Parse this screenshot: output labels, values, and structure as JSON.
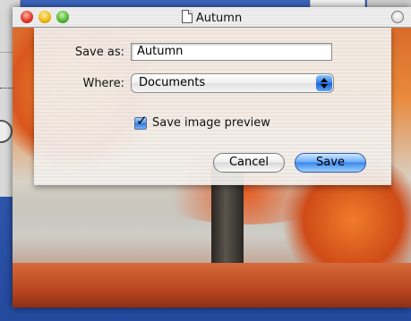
{
  "window": {
    "title": "Autumn"
  },
  "dialog": {
    "save_as_label": "Save as:",
    "save_as_value": "Autumn",
    "where_label": "Where:",
    "where_value": "Documents",
    "preview_checkbox_label": "Save image preview",
    "preview_checked": true,
    "cancel_label": "Cancel",
    "save_label": "Save"
  },
  "colors": {
    "default_button": "#3a87ea",
    "popup_arrows": "#2f7ee6",
    "traffic_close": "#e2392a",
    "traffic_minimize": "#f0b90f",
    "traffic_zoom": "#58b838"
  },
  "icons": {
    "title_doc": "document-icon",
    "popup": "updown-arrows-icon",
    "check": "checkmark-icon"
  }
}
